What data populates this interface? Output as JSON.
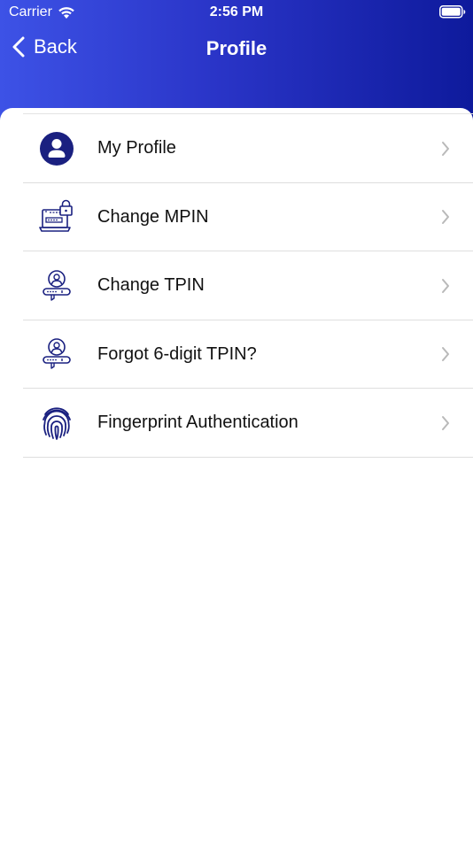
{
  "status_bar": {
    "carrier": "Carrier",
    "time": "2:56 PM",
    "icons": [
      "wifi-icon",
      "battery-icon"
    ]
  },
  "nav": {
    "back_label": "Back",
    "title": "Profile",
    "back_icon": "chevron-left-icon"
  },
  "menu": {
    "items": [
      {
        "label": "My Profile",
        "icon": "user-profile-icon"
      },
      {
        "label": "Change MPIN",
        "icon": "laptop-lock-icon"
      },
      {
        "label": "Change TPIN",
        "icon": "user-password-icon"
      },
      {
        "label": "Forgot 6-digit TPIN?",
        "icon": "user-password-icon"
      },
      {
        "label": "Fingerprint Authentication",
        "icon": "fingerprint-icon"
      }
    ],
    "chevron_icon": "chevron-right-icon"
  },
  "colors": {
    "header_gradient_start": "#3d52e6",
    "header_gradient_end": "#0e1a9c",
    "icon_primary": "#1a2080",
    "chevron": "#b9b9b9",
    "divider": "#dedede"
  }
}
